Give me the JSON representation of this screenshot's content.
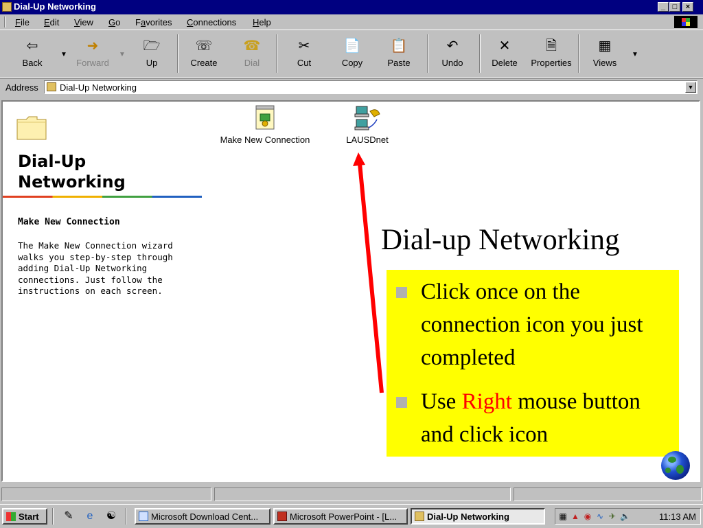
{
  "window": {
    "title": "Dial-Up Networking"
  },
  "menu": [
    {
      "label": "File",
      "key": "F"
    },
    {
      "label": "Edit",
      "key": "E"
    },
    {
      "label": "View",
      "key": "V"
    },
    {
      "label": "Go",
      "key": "G"
    },
    {
      "label": "Favorites",
      "key": "a"
    },
    {
      "label": "Connections",
      "key": "C"
    },
    {
      "label": "Help",
      "key": "H"
    }
  ],
  "toolbar": {
    "back": "Back",
    "forward": "Forward",
    "up": "Up",
    "create": "Create",
    "dial": "Dial",
    "cut": "Cut",
    "copy": "Copy",
    "paste": "Paste",
    "undo": "Undo",
    "delete": "Delete",
    "properties": "Properties",
    "views": "Views"
  },
  "address": {
    "label": "Address",
    "value": "Dial-Up Networking"
  },
  "panel": {
    "title_line1": "Dial-Up",
    "title_line2": "Networking",
    "subtitle": "Make New Connection",
    "description": "The Make New Connection wizard\nwalks you step-by-step through\nadding Dial-Up Networking\nconnections. Just follow the\ninstructions on each screen."
  },
  "items": [
    {
      "label": "Make New Connection",
      "icon": "make-new-connection-icon"
    },
    {
      "label": "LAUSDnet",
      "icon": "dialup-connection-icon"
    }
  ],
  "slide": {
    "title": "Dial-up Networking",
    "bullet1": "Click once on the connection icon you just completed",
    "bullet2_pre": "Use ",
    "bullet2_red": "Right",
    "bullet2_post": " mouse button and click icon",
    "box_color": "#ffff00",
    "arrow_color": "#ff0000"
  },
  "taskbar": {
    "start": "Start",
    "tasks": [
      {
        "label": "Microsoft Download Cent..."
      },
      {
        "label": "Microsoft PowerPoint - [L..."
      },
      {
        "label": "Dial-Up Networking"
      }
    ],
    "clock": "11:13 AM"
  }
}
